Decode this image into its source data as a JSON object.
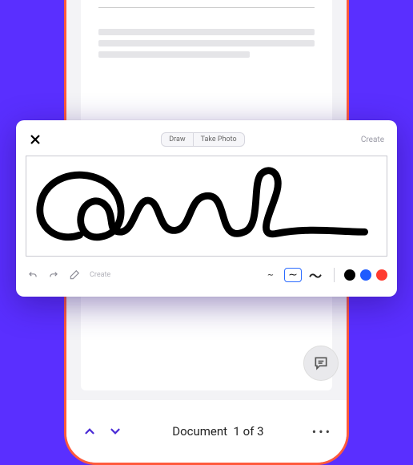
{
  "modal": {
    "tabs": {
      "draw": "Draw",
      "photo": "Take Photo"
    },
    "create": "Create",
    "bottomCreate": "Create",
    "strokeGlyphs": {
      "thin": "∼",
      "med": "∼",
      "thick": "〜"
    },
    "colors": {
      "black": "#000000",
      "blue": "#1e5bff",
      "red": "#ff3b30"
    }
  },
  "doc": {
    "counterPrefix": "Document",
    "counterValue": "1 of 3"
  }
}
